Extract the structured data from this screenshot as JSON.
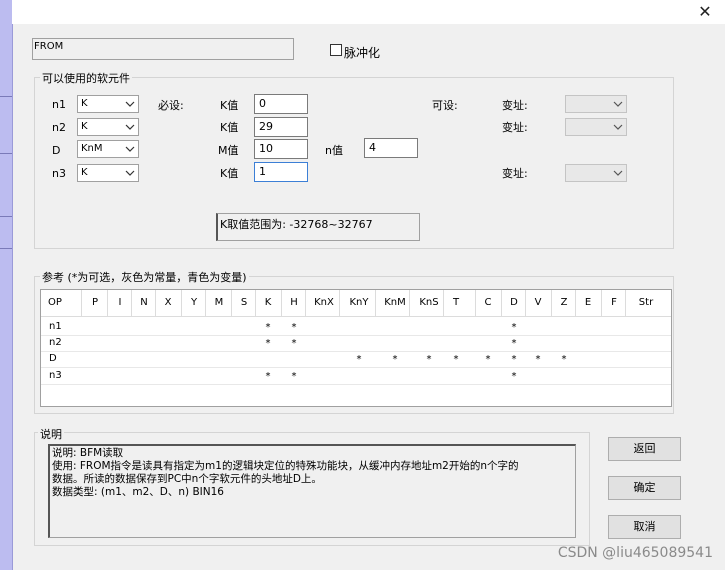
{
  "close_glyph": "✕",
  "instruction": {
    "value": "FROM"
  },
  "pulse": {
    "label": "脉冲化"
  },
  "operands_group": {
    "title": "可以使用的软元件",
    "required_label": "必设:",
    "optional_label": "可设:",
    "rows": [
      {
        "name": "n1",
        "type": "K",
        "field_label": "K值",
        "value": "0",
        "index_label": "变址:"
      },
      {
        "name": "n2",
        "type": "K",
        "field_label": "K值",
        "value": "29",
        "index_label": "变址:"
      },
      {
        "name": "D",
        "type": "KnM",
        "field_label": "M值",
        "value": "10",
        "n_label": "n值",
        "n_value": "4"
      },
      {
        "name": "n3",
        "type": "K",
        "field_label": "K值",
        "value": "1",
        "index_label": "变址:"
      }
    ],
    "range_text": "K取值范围为: -32768~32767"
  },
  "reference_group": {
    "title": "参考 (*为可选，灰色为常量，青色为变量)",
    "columns": [
      "OP",
      "P",
      "I",
      "N",
      "X",
      "Y",
      "M",
      "S",
      "K",
      "H",
      "KnX",
      "KnY",
      "KnM",
      "KnS",
      "T",
      "C",
      "D",
      "V",
      "Z",
      "E",
      "F",
      "Str"
    ],
    "rows": [
      {
        "op": "n1",
        "marks": [
          "K",
          "H",
          "D"
        ]
      },
      {
        "op": "n2",
        "marks": [
          "K",
          "H",
          "D"
        ]
      },
      {
        "op": "D",
        "marks": [
          "KnY",
          "KnM",
          "KnS",
          "T",
          "C",
          "D",
          "V",
          "Z"
        ]
      },
      {
        "op": "n3",
        "marks": [
          "K",
          "H",
          "D"
        ]
      }
    ],
    "mark_glyph": "*"
  },
  "description_group": {
    "title": "说明",
    "lines": [
      "说明: BFM读取",
      "使用: FROM指令是读具有指定为m1的逻辑块定位的特殊功能块，从缓冲内存地址m2开始的n个字的",
      "数据。所读的数据保存到PC中n个字软元件的头地址D上。",
      "数据类型: (m1、m2、D、n) BIN16"
    ]
  },
  "buttons": {
    "back": "返回",
    "ok": "确定",
    "cancel": "取消"
  },
  "watermark": "CSDN @liu465089541"
}
